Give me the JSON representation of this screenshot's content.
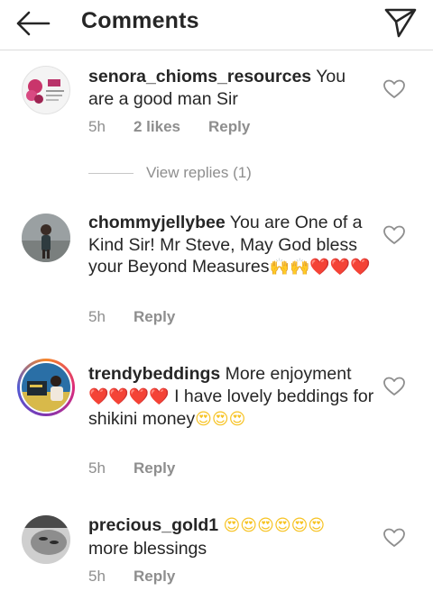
{
  "header": {
    "title": "Comments",
    "back_icon": "arrow-left-icon",
    "send_icon": "paper-plane-icon"
  },
  "comments": [
    {
      "username": "senora_chioms_resources",
      "text": " You are a good man Sir",
      "time": "5h",
      "likes": "2 likes",
      "reply": "Reply",
      "view_replies": "View replies (1)"
    },
    {
      "username": "chommyjellybee",
      "text": " You are One of a Kind Sir! Mr Steve, May God bless your Beyond Measures",
      "emojis": "🙌🙌❤️❤️❤️",
      "time": "5h",
      "reply": "Reply"
    },
    {
      "username": "trendybeddings",
      "text": " More enjoyment ",
      "hearts": "❤️❤️❤️❤️",
      "text2": " I have lovely beddings for shikini money",
      "emojis": "😍😍😍",
      "time": "5h",
      "reply": "Reply"
    },
    {
      "username": "precious_gold1",
      "emojis": "😍😍😍😍😍😍",
      "text": "more blessings",
      "time": "5h",
      "reply": "Reply"
    }
  ],
  "colors": {
    "text": "#262626",
    "secondary": "#8e8e8e",
    "divider": "#dbdbdb",
    "heart_red": "#e0243b"
  }
}
